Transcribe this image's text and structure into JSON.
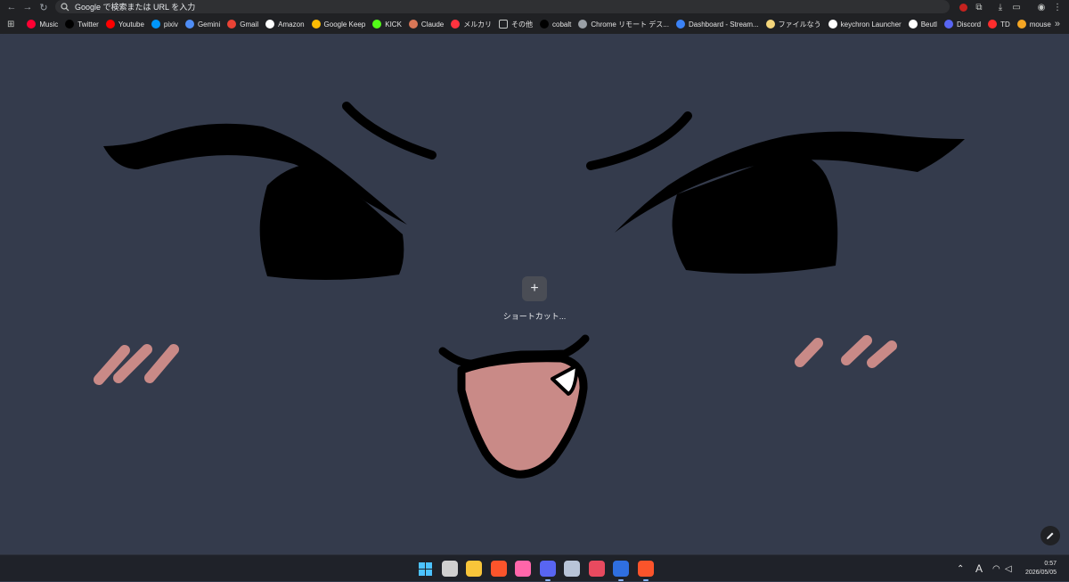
{
  "browser": {
    "omnibox": {
      "placeholder": "Google で検索または URL を入力"
    },
    "bookmarks": [
      {
        "label": "Music",
        "icon": "youtube-music-icon",
        "color": "#ff0033"
      },
      {
        "label": "Twitter",
        "icon": "x-icon",
        "color": "#000000"
      },
      {
        "label": "Youtube",
        "icon": "youtube-icon",
        "color": "#ff0000"
      },
      {
        "label": "pixiv",
        "icon": "pixiv-icon",
        "color": "#0096fa"
      },
      {
        "label": "Gemini",
        "icon": "gemini-icon",
        "color": "#4f8df5"
      },
      {
        "label": "Gmail",
        "icon": "gmail-icon",
        "color": "#ea4335"
      },
      {
        "label": "Amazon",
        "icon": "amazon-icon",
        "color": "#ffffff"
      },
      {
        "label": "Google Keep",
        "icon": "keep-icon",
        "color": "#fbbc04"
      },
      {
        "label": "KICK",
        "icon": "kick-icon",
        "color": "#53fc18"
      },
      {
        "label": "Claude",
        "icon": "claude-icon",
        "color": "#d97757"
      },
      {
        "label": "メルカリ",
        "icon": "mercari-icon",
        "color": "#ff333f"
      },
      {
        "label": "その他",
        "icon": "folder-icon",
        "color": "#c4c7c5"
      },
      {
        "label": "cobalt",
        "icon": "cobalt-icon",
        "color": "#000000"
      },
      {
        "label": "Chrome リモート デス...",
        "icon": "remote-desktop-icon",
        "color": "#9aa0a6"
      },
      {
        "label": "Dashboard - Stream...",
        "icon": "streamlabs-icon",
        "color": "#3b82f6"
      },
      {
        "label": "ファイルなう",
        "icon": "file-now-icon",
        "color": "#f5d67b"
      },
      {
        "label": "keychron Launcher",
        "icon": "keychron-icon",
        "color": "#ffffff"
      },
      {
        "label": "Beutl",
        "icon": "beutl-icon",
        "color": "#ffffff"
      },
      {
        "label": "Discord",
        "icon": "discord-icon",
        "color": "#5865f2"
      },
      {
        "label": "TD",
        "icon": "td-icon",
        "color": "#ff2d2d"
      },
      {
        "label": "mouse",
        "icon": "mouse-icon",
        "color": "#f5a623"
      }
    ]
  },
  "ntp": {
    "shortcut_add": {
      "icon": "plus-icon",
      "label": "ショートカット..."
    },
    "customize": {
      "icon": "pencil-icon"
    }
  },
  "taskbar": {
    "apps": [
      {
        "name": "start-button",
        "icon": "windows-icon",
        "color": "#4cc2ff",
        "active": false
      },
      {
        "name": "task-view",
        "icon": "task-view-icon",
        "color": "#d0d0d0",
        "active": false
      },
      {
        "name": "file-explorer",
        "icon": "folder-icon",
        "color": "#f8c53a",
        "active": false
      },
      {
        "name": "brave",
        "icon": "brave-icon",
        "color": "#fb542b",
        "active": false
      },
      {
        "name": "osu",
        "icon": "osu-icon",
        "color": "#ff66aa",
        "active": false
      },
      {
        "name": "discord",
        "icon": "discord-icon",
        "color": "#5865f2",
        "active": true
      },
      {
        "name": "app-7",
        "icon": "character-icon",
        "color": "#b8c4d8",
        "active": false
      },
      {
        "name": "app-8",
        "icon": "robot-icon",
        "color": "#e84a5f",
        "active": false
      },
      {
        "name": "app-9",
        "icon": "snowflake-icon",
        "color": "#2f6fe0",
        "active": true
      },
      {
        "name": "brave-beta",
        "icon": "brave-icon",
        "color": "#fb542b",
        "active": true
      }
    ],
    "tray": {
      "input_mode": "A",
      "time": "0:57",
      "date": "2026/05/05"
    }
  },
  "colors": {
    "background": "#343b4c",
    "blush": "#c98a87",
    "tongue": "#c98a87"
  }
}
